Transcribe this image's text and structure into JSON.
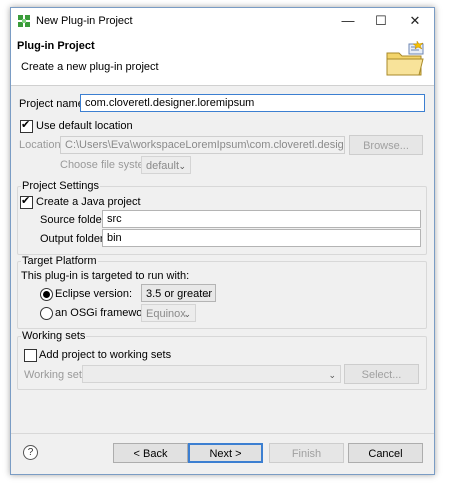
{
  "window": {
    "title": "New Plug-in Project",
    "minimize_glyph": "—",
    "maximize_glyph": "☐",
    "close_glyph": "✕"
  },
  "banner": {
    "title": "Plug-in Project",
    "subtitle": "Create a new plug-in project",
    "icon": "folder-wizard-icon"
  },
  "project": {
    "name_label": "Project name:",
    "name_value": "com.cloveretl.designer.loremipsum",
    "use_default_label": "Use default location",
    "use_default_checked": true,
    "location_label": "Location:",
    "location_value": "C:\\Users\\Eva\\workspaceLoremIpsum\\com.cloveretl.designer.loremip",
    "browse_label": "Browse...",
    "filesystem_label": "Choose file system:",
    "filesystem_value": "default"
  },
  "settings": {
    "group_title": "Project Settings",
    "java_label": "Create a Java project",
    "java_checked": true,
    "source_label": "Source folder:",
    "source_value": "src",
    "output_label": "Output folder:",
    "output_value": "bin"
  },
  "target": {
    "group_title": "Target Platform",
    "intro": "This plug-in is targeted to run with:",
    "eclipse_label": "Eclipse version:",
    "eclipse_selected": true,
    "eclipse_value": "3.5 or greater",
    "osgi_label": "an OSGi framework:",
    "osgi_value": "Equinox"
  },
  "working_sets": {
    "group_title": "Working sets",
    "add_label": "Add project to working sets",
    "add_checked": false,
    "sets_label": "Working sets:",
    "sets_value": "",
    "select_label": "Select..."
  },
  "footer": {
    "help_glyph": "?",
    "back_label": "< Back",
    "next_label": "Next >",
    "finish_label": "Finish",
    "cancel_label": "Cancel"
  }
}
